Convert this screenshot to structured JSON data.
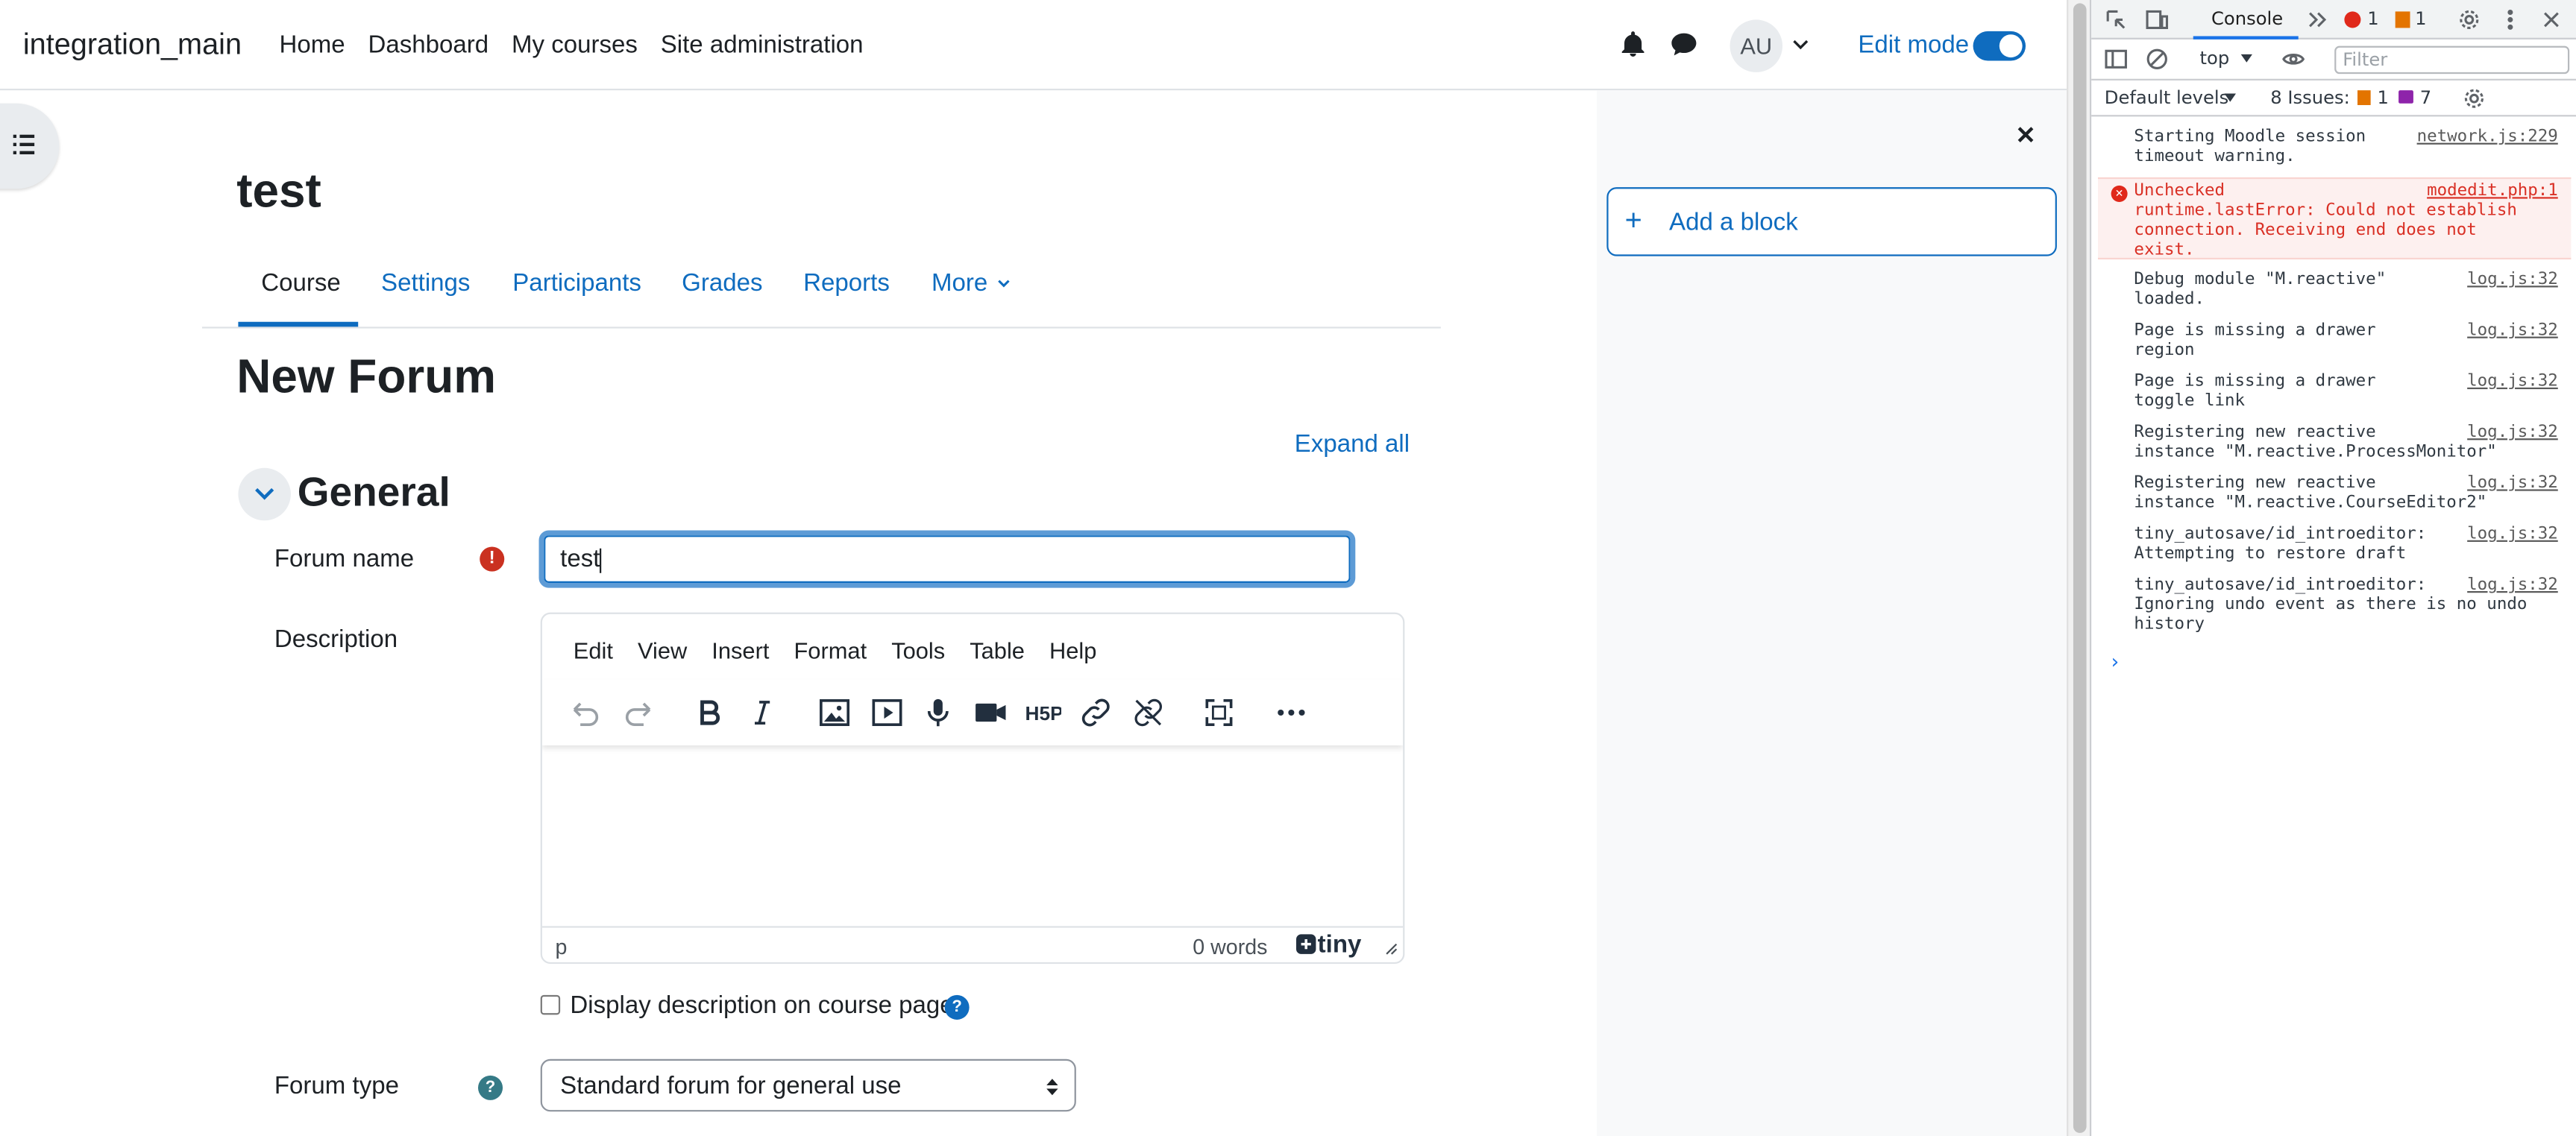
{
  "navbar": {
    "brand": "integration_main",
    "links": [
      "Home",
      "Dashboard",
      "My courses",
      "Site administration"
    ],
    "avatar_initials": "AU",
    "edit_mode_label": "Edit mode",
    "edit_mode_on": true
  },
  "course": {
    "title": "test",
    "tabs": [
      "Course",
      "Settings",
      "Participants",
      "Grades",
      "Reports",
      "More"
    ],
    "active_tab": "Course"
  },
  "form": {
    "page_title": "New Forum",
    "expand_all": "Expand all",
    "section_title": "General",
    "forum_name_label": "Forum name",
    "forum_name_value": "test",
    "required_icon": "!",
    "description_label": "Description",
    "editor": {
      "menu": [
        "Edit",
        "View",
        "Insert",
        "Format",
        "Tools",
        "Table",
        "Help"
      ],
      "status_path": "p",
      "word_count": "0 words",
      "brand": "tiny"
    },
    "display_description_label": "Display description on course page",
    "display_description_checked": false,
    "help_glyph": "?",
    "forum_type_label": "Forum type",
    "forum_type_value": "Standard forum for general use"
  },
  "right_drawer": {
    "add_block_label": "Add a block",
    "plus_glyph": "+"
  },
  "devtools": {
    "active_tab": "Console",
    "error_count": "1",
    "warning_count": "1",
    "context": "top",
    "filter_placeholder": "Filter",
    "levels": "Default levels",
    "issues_label": "8 Issues:",
    "issues_warn": "1",
    "issues_info": "7",
    "logs": [
      {
        "msg": "Starting Moodle session\ntimeout warning.",
        "src": "network.js:229",
        "level": "info"
      },
      {
        "msg": "Unchecked\nruntime.lastError: Could not establish\nconnection. Receiving end does not\nexist.",
        "src": "modedit.php:1",
        "level": "error"
      },
      {
        "msg": "Debug module \"M.reactive\"\nloaded.",
        "src": "log.js:32",
        "level": "info"
      },
      {
        "msg": "Page is missing a drawer\nregion",
        "src": "log.js:32",
        "level": "info"
      },
      {
        "msg": "Page is missing a drawer\ntoggle link",
        "src": "log.js:32",
        "level": "info"
      },
      {
        "msg": "Registering new reactive\ninstance \"M.reactive.ProcessMonitor\"",
        "src": "log.js:32",
        "level": "info"
      },
      {
        "msg": "Registering new reactive\ninstance \"M.reactive.CourseEditor2\"",
        "src": "log.js:32",
        "level": "info"
      },
      {
        "msg": "tiny_autosave/id_introeditor:\nAttempting to restore draft",
        "src": "log.js:32",
        "level": "info"
      },
      {
        "msg": "tiny_autosave/id_introeditor:\nIgnoring undo event as there is no undo\nhistory",
        "src": "log.js:32",
        "level": "info"
      }
    ],
    "prompt_glyph": "›"
  }
}
